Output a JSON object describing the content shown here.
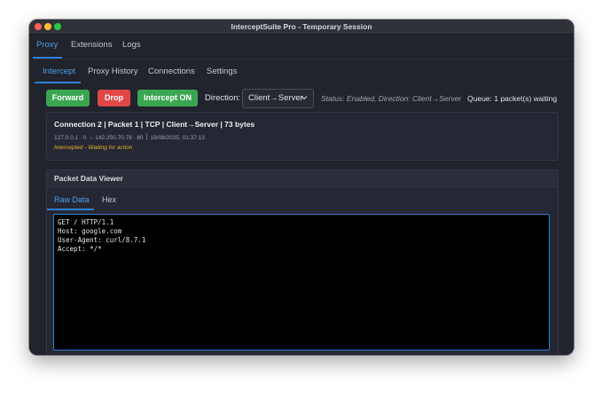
{
  "window": {
    "title": "InterceptSuite Pro - Temporary Session"
  },
  "top_tabs": [
    {
      "label": "Proxy",
      "active": true
    },
    {
      "label": "Extensions",
      "active": false
    },
    {
      "label": "Logs",
      "active": false
    }
  ],
  "sub_tabs": [
    {
      "label": "Intercept",
      "active": true
    },
    {
      "label": "Proxy History",
      "active": false
    },
    {
      "label": "Connections",
      "active": false
    },
    {
      "label": "Settings",
      "active": false
    }
  ],
  "toolbar": {
    "forward_label": "Forward",
    "drop_label": "Drop",
    "intercept_label": "Intercept ON",
    "direction_label": "Direction:",
    "direction_value": "Client→Server",
    "status_text": "Status: Enabled, Direction: Client→Server",
    "queue_text": "Queue: 1 packet(s) waiting"
  },
  "connection": {
    "title": "Connection 2 | Packet 1 | TCP | Client→Server | 73 bytes",
    "route": "127.0.0.1 : 0  →  142.250.70.78 : 80",
    "timestamp": "19/08/2025, 01:37:13",
    "state": "Intercepted - Waiting for action"
  },
  "viewer": {
    "title": "Packet Data Viewer",
    "tabs": [
      {
        "label": "Raw Data",
        "active": true
      },
      {
        "label": "Hex",
        "active": false
      }
    ],
    "raw_lines": [
      "GET / HTTP/1.1",
      "Host: google.com",
      "User-Agent: curl/8.7.1",
      "Accept: */*"
    ]
  },
  "colors": {
    "accent": "#2f7fd0",
    "forward": "#3aa652",
    "drop": "#e04848",
    "intercept": "#3aa652",
    "warning": "#e0b62e",
    "background": "#21232d"
  }
}
